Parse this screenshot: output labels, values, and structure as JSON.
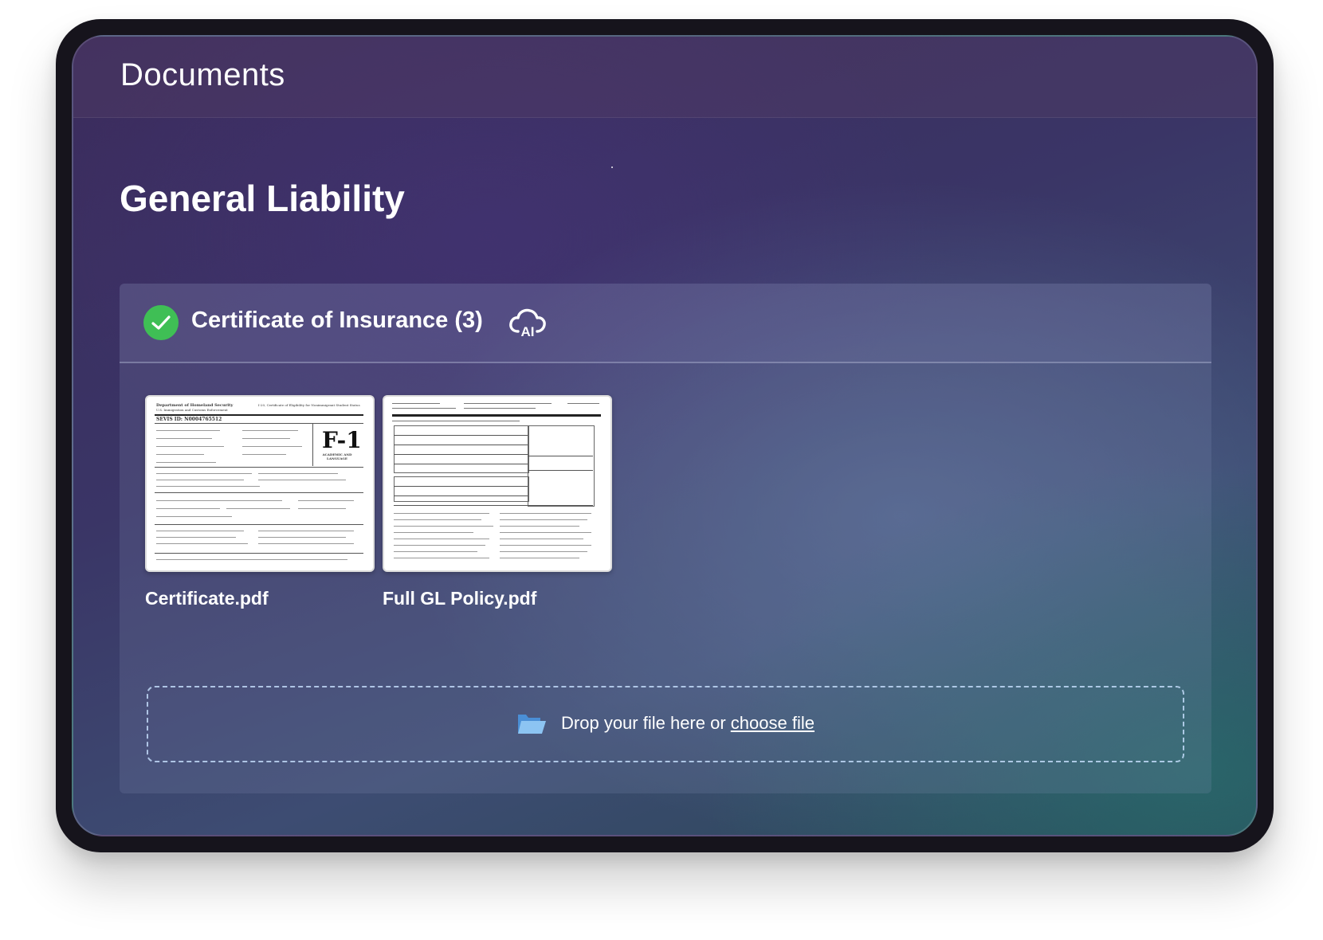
{
  "header": {
    "title": "Documents"
  },
  "section": {
    "title": "General Liability"
  },
  "category": {
    "title": "Certificate of Insurance (3)",
    "ai_icon": "cloud-ai-icon",
    "status_icon": "check-circle-icon",
    "status_color": "#3fbf55"
  },
  "documents": [
    {
      "name": "Certificate.pdf",
      "thumb_heading": "F-1",
      "thumb_sub": "ACADEMIC AND LANGUAGE",
      "thumb_id": "SEVIS ID: N0004765512"
    },
    {
      "name": "Full GL Policy.pdf"
    }
  ],
  "dropzone": {
    "text": "Drop your file here or ",
    "link": "choose file",
    "icon": "folder-icon"
  }
}
